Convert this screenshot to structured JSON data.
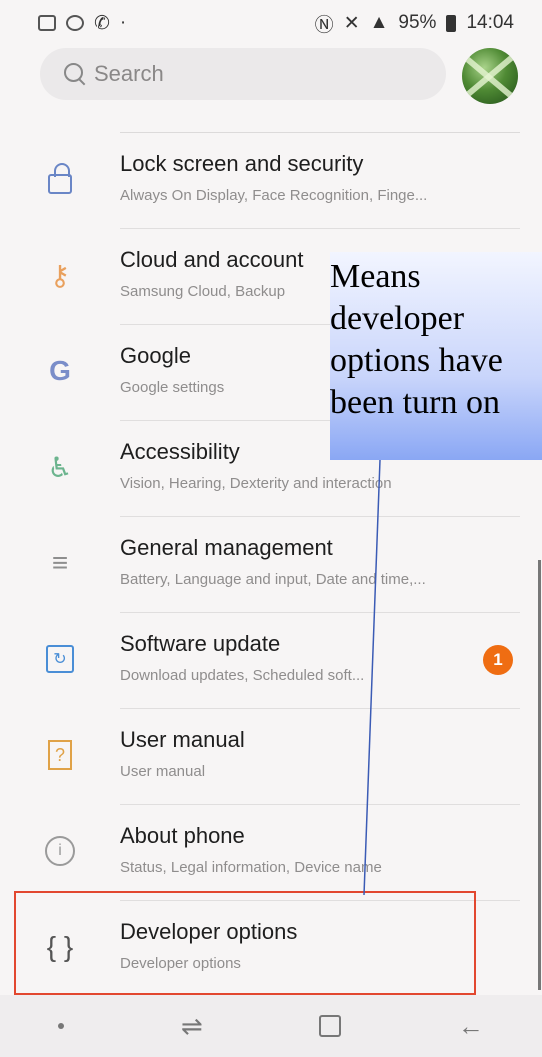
{
  "status_bar": {
    "battery_percent": "95%",
    "time": "14:04"
  },
  "search": {
    "placeholder": "Search"
  },
  "items": [
    {
      "title": "Lock screen and security",
      "subtitle": "Always On Display, Face Recognition, Finge..."
    },
    {
      "title": "Cloud and account",
      "subtitle": "Samsung Cloud, Backup"
    },
    {
      "title": "Google",
      "subtitle": "Google settings"
    },
    {
      "title": "Accessibility",
      "subtitle": "Vision, Hearing, Dexterity and interaction"
    },
    {
      "title": "General management",
      "subtitle": "Battery, Language and input, Date and time,..."
    },
    {
      "title": "Software update",
      "subtitle": "Download updates, Scheduled soft...",
      "badge": "1"
    },
    {
      "title": "User manual",
      "subtitle": "User manual"
    },
    {
      "title": "About phone",
      "subtitle": "Status, Legal information, Device name"
    },
    {
      "title": "Developer options",
      "subtitle": "Developer options"
    }
  ],
  "annotation": {
    "text": "Means\ndeveloper\noptions have\nbeen turn on"
  },
  "colors": {
    "highlight_border": "#e2472f",
    "badge": "#ef6d12"
  }
}
